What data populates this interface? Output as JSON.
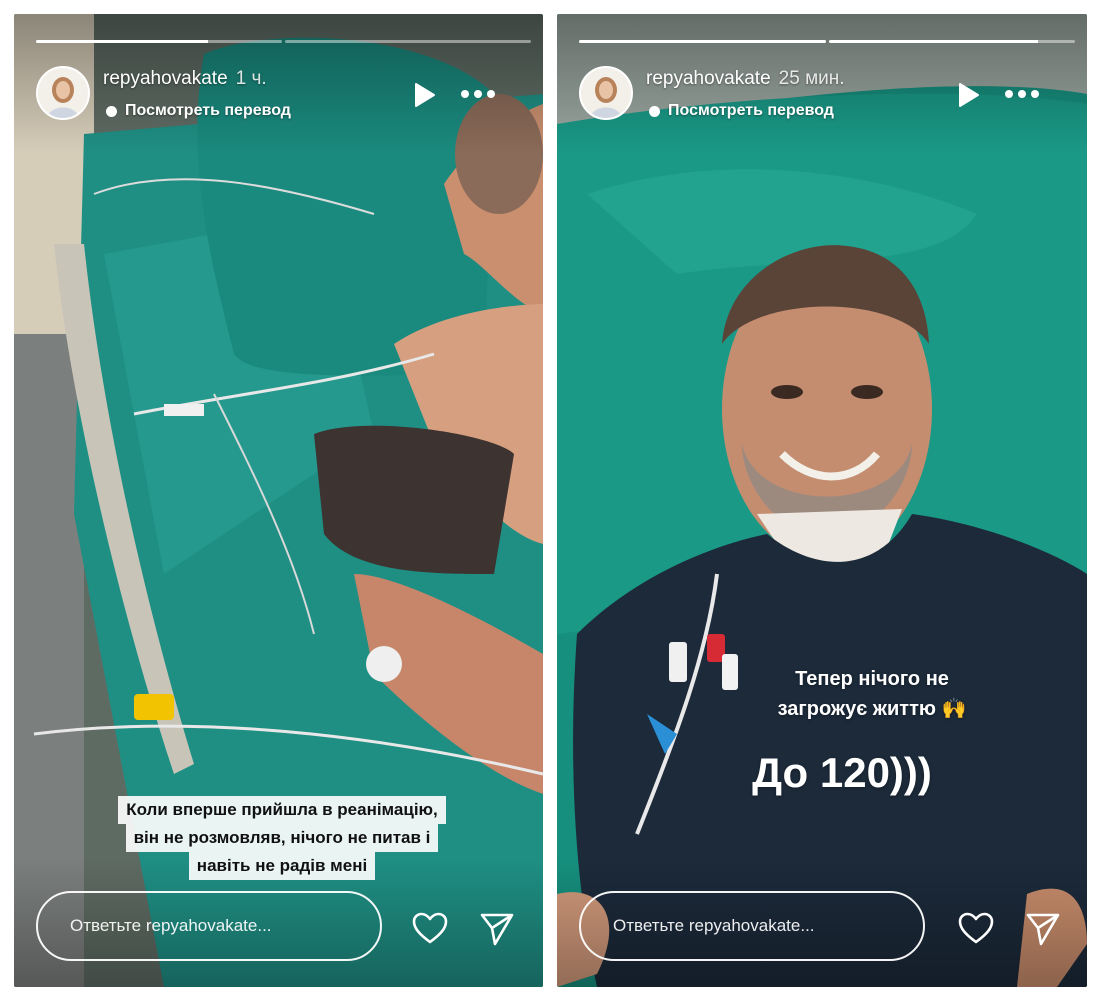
{
  "stories": [
    {
      "username": "repyahovakate",
      "time": "1 ч.",
      "translate_label": "Посмотреть перевод",
      "caption_lines": [
        "Коли вперше прийшла в реанімацію,",
        "він не розмовляв, нічого не питав і",
        "навіть не радів мені"
      ],
      "reply_placeholder": "Ответьте repyahovakate...",
      "progress": {
        "segments": 2,
        "active_index": 0,
        "active_fill": 0.7
      }
    },
    {
      "username": "repyahovakate",
      "time": "25 мин.",
      "translate_label": "Посмотреть перевод",
      "overlay_line1": "Тепер нічого не",
      "overlay_line2": "загрожує життю 🙌",
      "overlay_big": "До 120)))",
      "reply_placeholder": "Ответьте repyahovakate...",
      "progress": {
        "segments": 2,
        "active_index": 1,
        "active_fill": 0.85
      }
    }
  ],
  "icons": {
    "play": "play-icon",
    "more": "more-options-icon",
    "heart": "heart-icon",
    "send": "send-icon",
    "translate": "translate-dot-icon"
  },
  "colors": {
    "sheet_teal": "#1f8f84",
    "shirt_navy": "#1c2a3a",
    "text_white": "#ffffff"
  }
}
